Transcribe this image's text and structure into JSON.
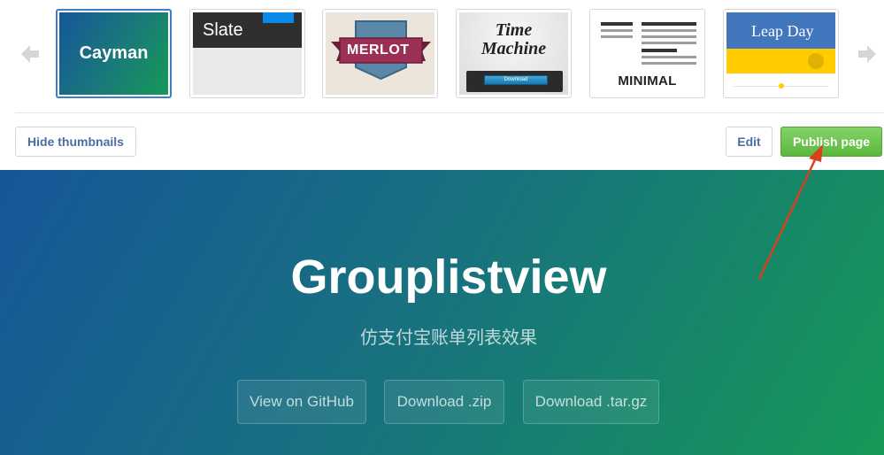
{
  "theme_chooser": {
    "themes": [
      {
        "name": "Cayman",
        "selected": true
      },
      {
        "name": "Slate"
      },
      {
        "name": "MERLOT"
      },
      {
        "name": "Time Machine",
        "line1": "Time",
        "line2": "Machine",
        "button": "Download"
      },
      {
        "name": "MINIMAL"
      },
      {
        "name": "Leap Day"
      }
    ],
    "hide_thumbnails_label": "Hide thumbnails",
    "edit_label": "Edit",
    "publish_label": "Publish page",
    "colors": {
      "selected_border": "#3e7ec8",
      "publish_green": "#5ab83b",
      "link_blue": "#4a6da3"
    }
  },
  "preview": {
    "title": "Grouplistview",
    "subtitle": "仿支付宝账单列表效果",
    "buttons": [
      "View on GitHub",
      "Download .zip",
      "Download .tar.gz"
    ],
    "gradient": [
      "#155799",
      "#159957"
    ]
  },
  "annotation": {
    "arrow_color": "#d8401f"
  }
}
